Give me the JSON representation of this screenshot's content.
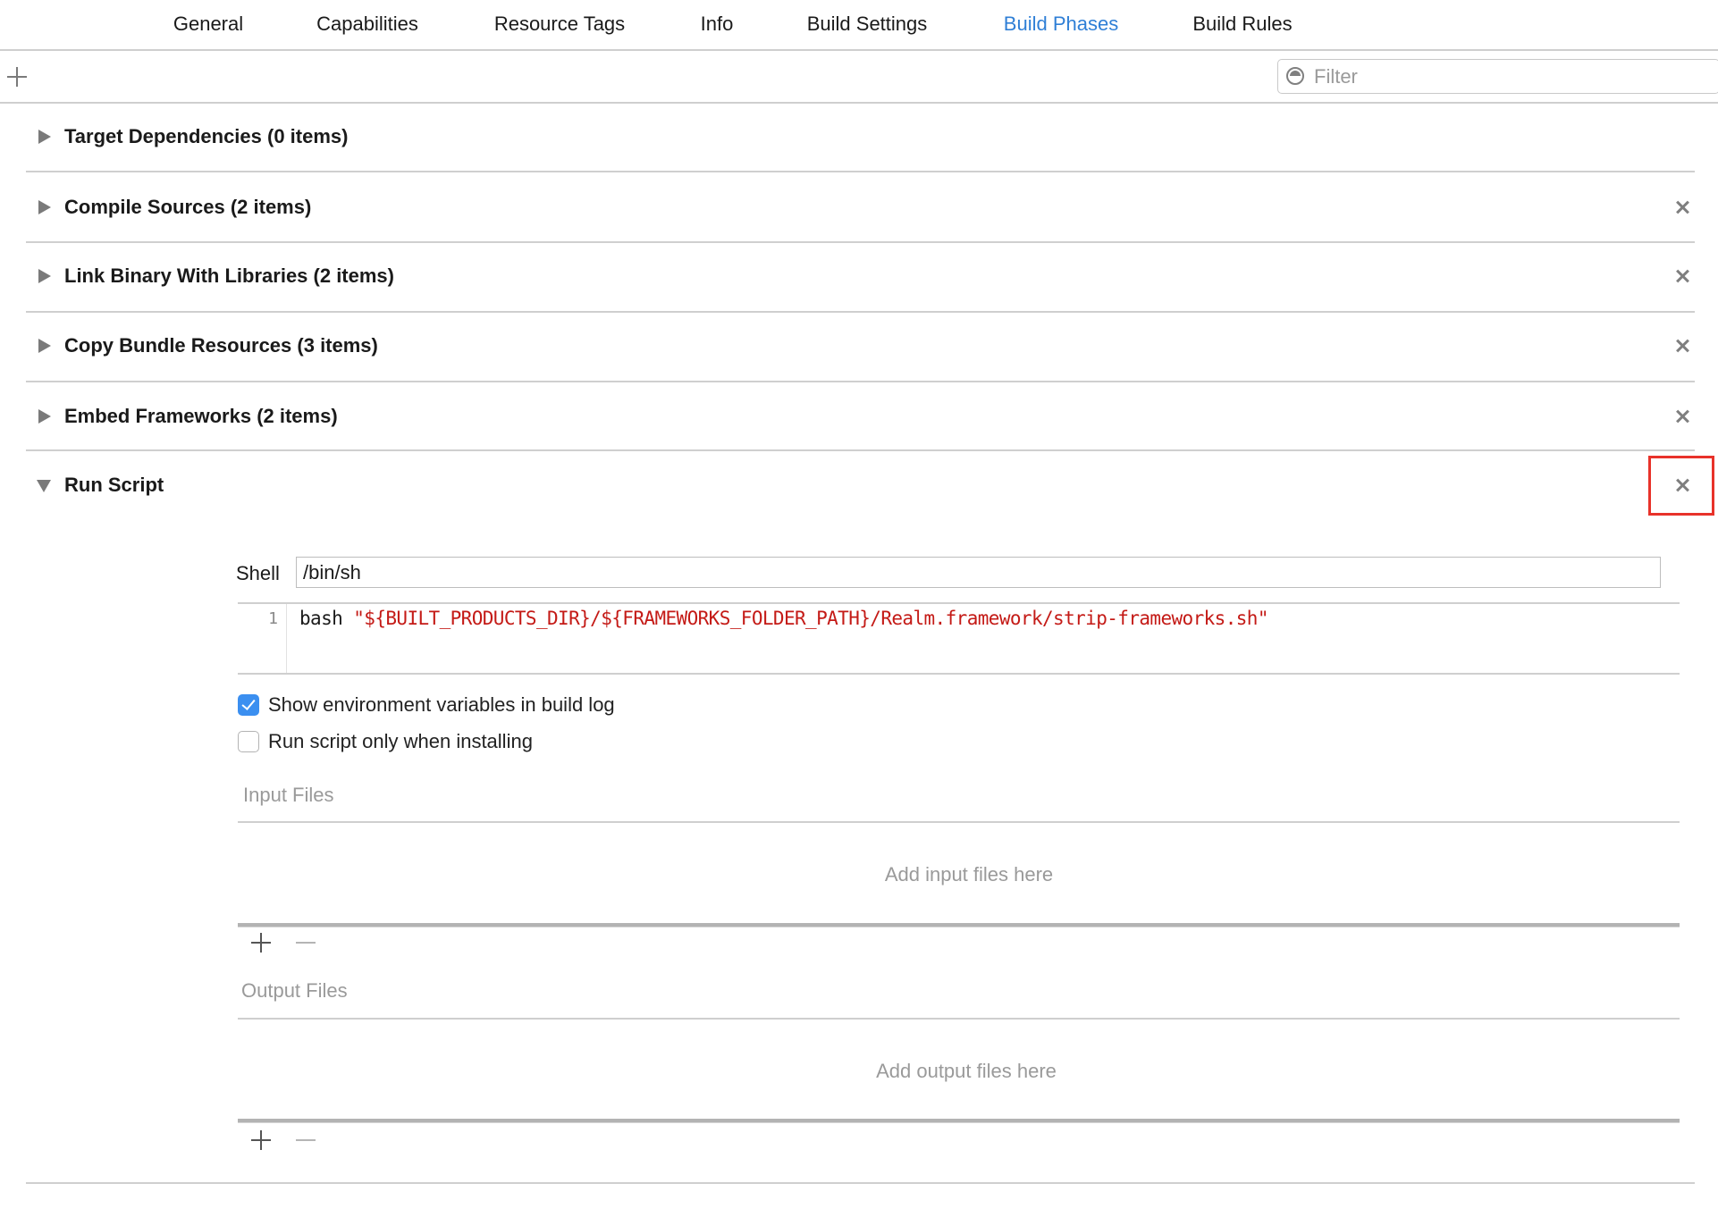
{
  "tabs": [
    {
      "label": "General",
      "active": false
    },
    {
      "label": "Capabilities",
      "active": false
    },
    {
      "label": "Resource Tags",
      "active": false
    },
    {
      "label": "Info",
      "active": false
    },
    {
      "label": "Build Settings",
      "active": false
    },
    {
      "label": "Build Phases",
      "active": true
    },
    {
      "label": "Build Rules",
      "active": false
    }
  ],
  "toolbar": {
    "add_icon": "plus-icon",
    "filter_placeholder": "Filter",
    "filter_icon": "filter-icon",
    "filter_value": ""
  },
  "phases": [
    {
      "title": "Target Dependencies (0 items)",
      "expanded": false,
      "deletable": false
    },
    {
      "title": "Compile Sources (2 items)",
      "expanded": false,
      "deletable": true
    },
    {
      "title": "Link Binary With Libraries (2 items)",
      "expanded": false,
      "deletable": true
    },
    {
      "title": "Copy Bundle Resources (3 items)",
      "expanded": false,
      "deletable": true
    },
    {
      "title": "Embed Frameworks (2 items)",
      "expanded": false,
      "deletable": true
    },
    {
      "title": "Run Script",
      "expanded": true,
      "deletable": true,
      "highlighted_delete": true
    }
  ],
  "run_script": {
    "shell_label": "Shell",
    "shell_value": "/bin/sh",
    "script_lines": [
      {
        "number": "1",
        "keyword": "bash",
        "string": "\"${BUILT_PRODUCTS_DIR}/${FRAMEWORKS_FOLDER_PATH}/Realm.framework/strip-frameworks.sh\""
      }
    ],
    "options": [
      {
        "label": "Show environment variables in build log",
        "checked": true
      },
      {
        "label": "Run script only when installing",
        "checked": false
      }
    ],
    "input_files": {
      "label": "Input Files",
      "placeholder": "Add input files here"
    },
    "output_files": {
      "label": "Output Files",
      "placeholder": "Add output files here"
    }
  },
  "colors": {
    "accent": "#2f7fd6",
    "string_literal": "#c41a16",
    "checkbox": "#3b8ff0",
    "highlight_box": "#e8322a"
  }
}
